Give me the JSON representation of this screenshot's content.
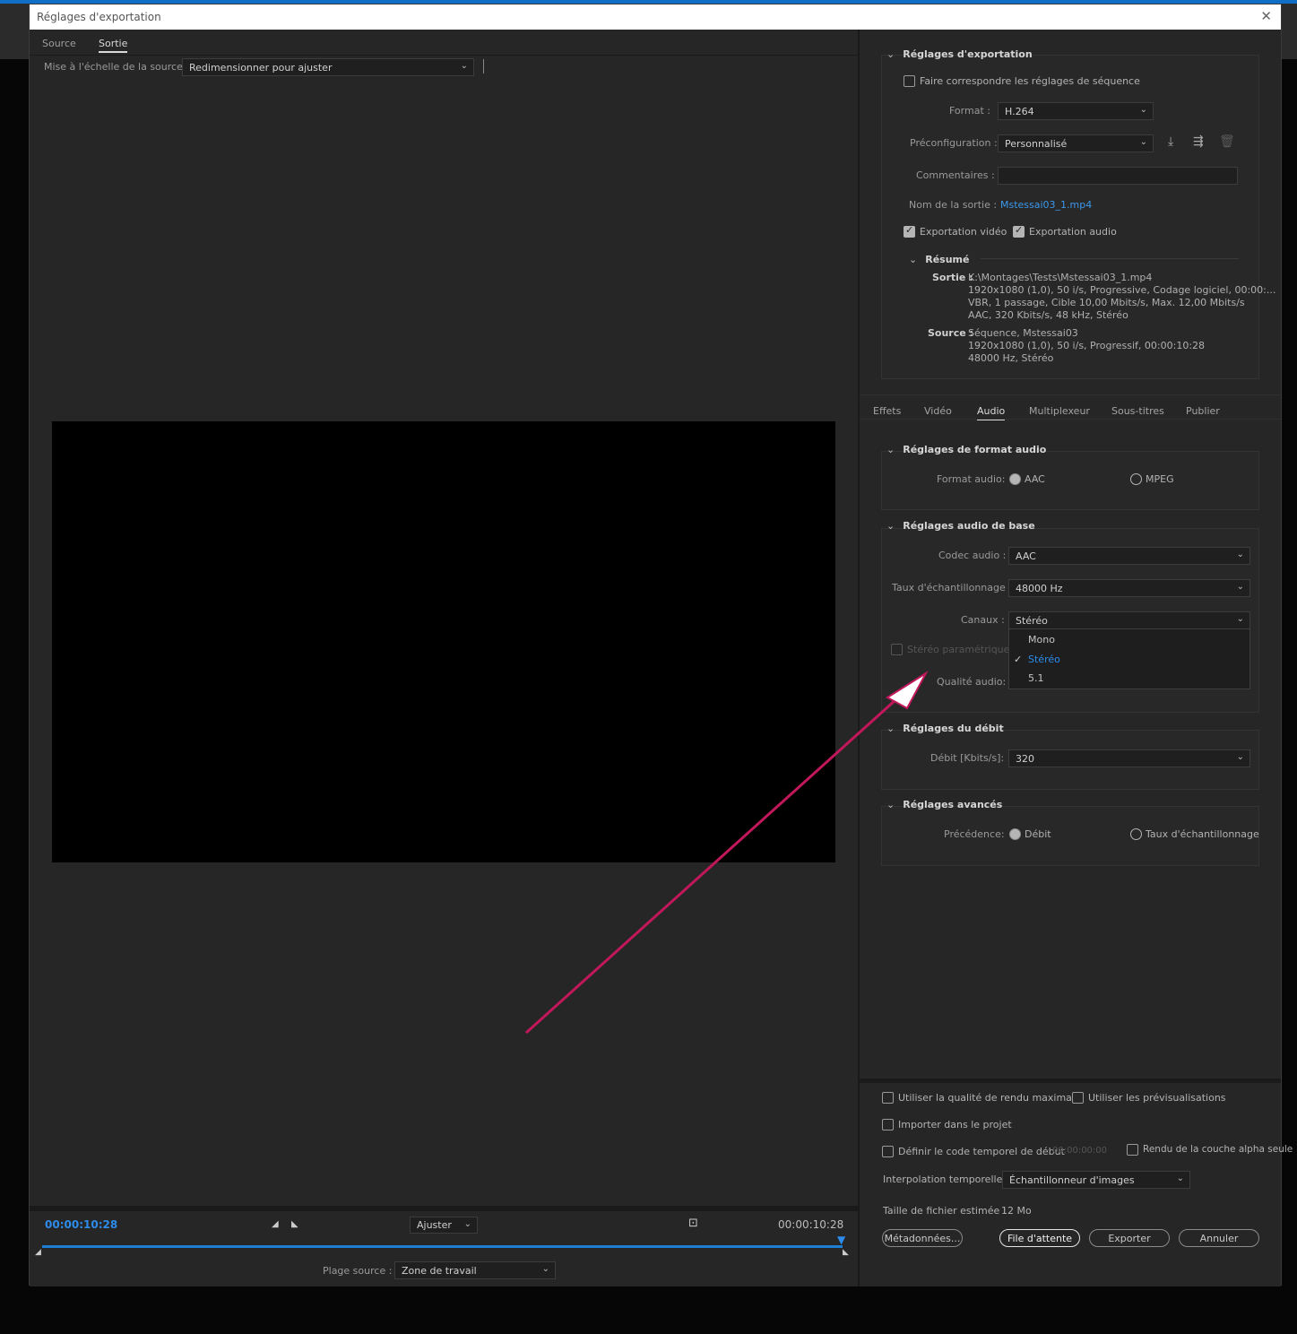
{
  "window": {
    "title": "Réglages d'exportation",
    "close": "✕"
  },
  "left_tabs": [
    {
      "label": "Source"
    },
    {
      "label": "Sortie"
    }
  ],
  "scale": {
    "label": "Mise à l'échelle de la source :",
    "value": "Redimensionner pour ajuster"
  },
  "timeline": {
    "tc_in": "00:00:10:28",
    "tc_out": "00:00:10:28",
    "fit_value": "Ajuster",
    "range_label": "Plage source :",
    "range_value": "Zone de travail",
    "playhead_fraction": 1.0
  },
  "export_settings": {
    "header": "Réglages d'exportation",
    "match_seq": "Faire correspondre les réglages de séquence",
    "format_label": "Format :",
    "format_value": "H.264",
    "preset_label": "Préconfiguration :",
    "preset_value": "Personnalisé",
    "comments_label": "Commentaires :",
    "comments_value": "",
    "output_label": "Nom de la sortie :",
    "output_value": "Mstessai03_1.mp4",
    "export_video": "Exportation vidéo",
    "export_audio": "Exportation audio",
    "summary_header": "Résumé",
    "sortie_label": "Sortie :",
    "sortie_lines": [
      "K:\\Montages\\Tests\\Mstessai03_1.mp4",
      "1920x1080 (1,0), 50 i/s, Progressive, Codage logiciel, 00:00:...",
      "VBR, 1 passage, Cible 10,00  Mbits/s, Max. 12,00  Mbits/s",
      "AAC, 320  Kbits/s, 48  kHz, Stéréo"
    ],
    "source_label": "Source :",
    "source_lines": [
      "Séquence, Mstessai03",
      "1920x1080 (1,0), 50  i/s, Progressif, 00:00:10:28",
      "48000 Hz, Stéréo"
    ]
  },
  "right_tabs": [
    {
      "label": "Effets"
    },
    {
      "label": "Vidéo"
    },
    {
      "label": "Audio"
    },
    {
      "label": "Multiplexeur"
    },
    {
      "label": "Sous-titres"
    },
    {
      "label": "Publier"
    }
  ],
  "audio_format": {
    "header": "Réglages de format audio",
    "label": "Format audio:",
    "opt1": "AAC",
    "opt2": "MPEG"
  },
  "audio_basic": {
    "header": "Réglages audio de base",
    "codec_label": "Codec audio :",
    "codec_value": "AAC",
    "rate_label": "Taux d'échantillonnage :",
    "rate_value": "48000  Hz",
    "channels_label": "Canaux :",
    "channels_value": "Stéréo",
    "param_stereo": "Stéréo paramétrique",
    "quality_label": "Qualité audio:",
    "channel_options": [
      "Mono",
      "Stéréo",
      "5.1"
    ],
    "check": "✓"
  },
  "bitrate": {
    "header": "Réglages du débit",
    "label": "Débit [Kbits/s]:",
    "value": "320"
  },
  "advanced": {
    "header": "Réglages avancés",
    "label": "Précédence:",
    "opt1": "Débit",
    "opt2": "Taux d'échantillonnage"
  },
  "bottom": {
    "max_quality": "Utiliser la qualité de rendu maximale",
    "use_previews": "Utiliser les prévisualisations",
    "import_project": "Importer dans le projet",
    "set_tc": "Définir le code temporel de début",
    "tc_value": "00:00:00:00",
    "alpha": "Rendu de la couche alpha seule",
    "interp_label": "Interpolation temporelle :",
    "interp_value": "Échantillonneur d'images",
    "size_label": "Taille de fichier estimée :",
    "size_value": "12 Mo",
    "btn_meta": "Métadonnées...",
    "btn_queue": "File d'attente",
    "btn_export": "Exporter",
    "btn_cancel": "Annuler"
  },
  "colors": {
    "accent": "#2d8ceb",
    "arrow": "#c2185b",
    "topbar": "#0f6fc6"
  },
  "icons": [
    "chevron-down-icon",
    "download-preset-icon",
    "import-preset-icon",
    "trash-icon",
    "mark-in-icon",
    "mark-out-icon",
    "crop-icon",
    "playhead-icon",
    "close-icon"
  ]
}
